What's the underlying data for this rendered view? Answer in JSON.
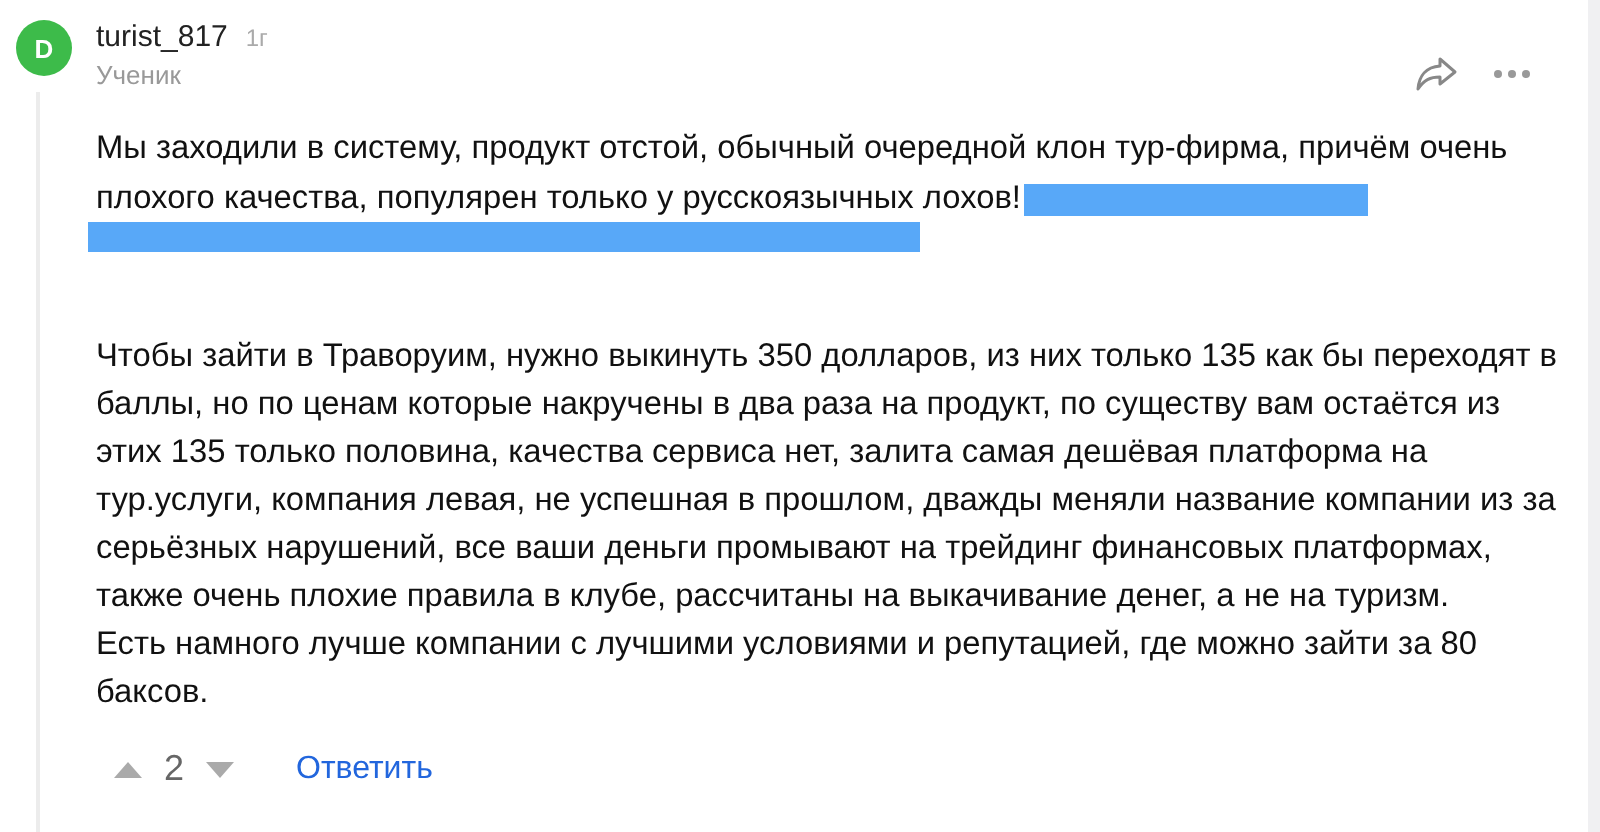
{
  "comment": {
    "avatar_letter": "D",
    "author": "turist_817",
    "time": "1г",
    "rank": "Ученик",
    "paragraphs": [
      {
        "text": "Мы заходили в систему, продукт отстой, обычный очередной клон тур-фирма, причём очень плохого качества, популярен только у русскоязычных лохов!",
        "redacted": true
      },
      {
        "text": "Чтобы зайти в Траворуим, нужно выкинуть 350 долларов, из них только 135 как бы переходят в баллы, но по ценам которые накручены в два раза на продукт, по существу вам остаётся из этих 135 только половина, качества сервиса нет, залита самая дешёвая платформа на тур.услуги, компания левая, не успешная в прошлом, дважды меняли название компании из за серьёзных нарушений, все ваши деньги промывают на трейдинг финансовых платформах, также очень плохие правила в клубе, рассчитаны на выкачивание денег, а не на туризм.\nЕсть намного лучше компании с лучшими условиями и репутацией, где можно зайти за 80 баксов.",
        "redacted": false
      }
    ],
    "votes": "2",
    "reply": "Ответить"
  }
}
